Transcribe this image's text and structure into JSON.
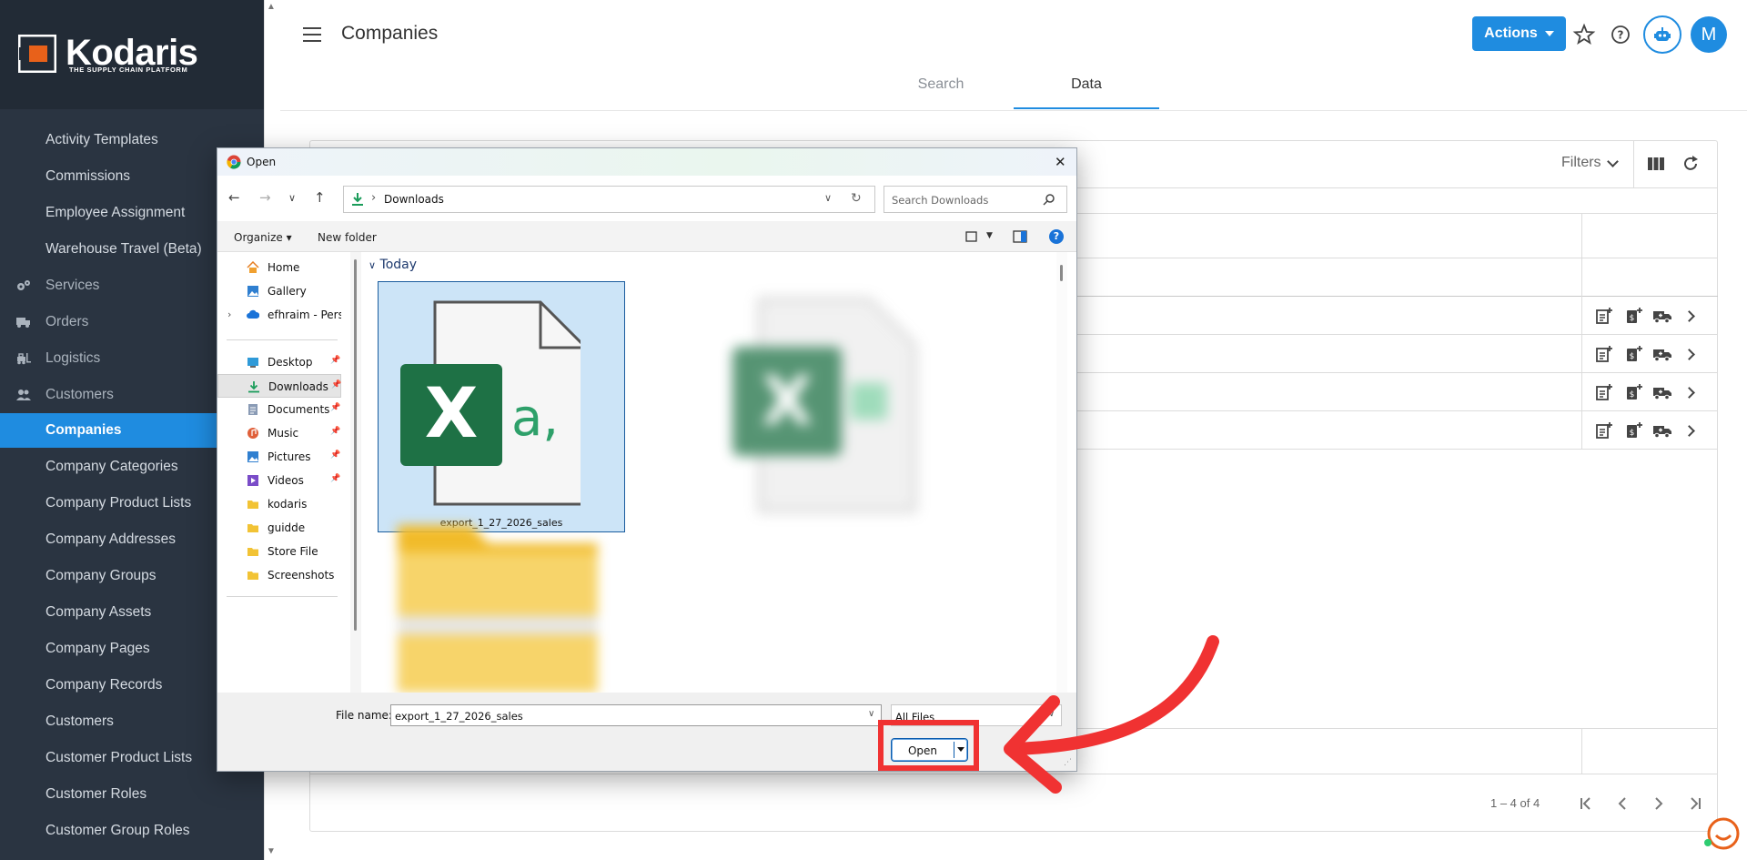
{
  "app": {
    "logo_text": "Kodaris",
    "logo_tagline": "THE SUPPLY CHAIN PLATFORM",
    "page_title": "Companies",
    "actions_label": "Actions",
    "avatar_initial": "M"
  },
  "tabs": [
    {
      "label": "Search",
      "active": false
    },
    {
      "label": "Data",
      "active": true
    }
  ],
  "sidebar": {
    "items": [
      {
        "label": "Activity Templates",
        "type": "child"
      },
      {
        "label": "Commissions",
        "type": "child"
      },
      {
        "label": "Employee Assignment",
        "type": "child"
      },
      {
        "label": "Warehouse Travel (Beta)",
        "type": "child"
      },
      {
        "label": "Services",
        "type": "parent",
        "icon": "gears-icon"
      },
      {
        "label": "Orders",
        "type": "parent",
        "icon": "truck-icon"
      },
      {
        "label": "Logistics",
        "type": "parent",
        "icon": "forklift-icon"
      },
      {
        "label": "Customers",
        "type": "parent",
        "icon": "people-icon"
      },
      {
        "label": "Companies",
        "type": "child",
        "active": true
      },
      {
        "label": "Company Categories",
        "type": "child"
      },
      {
        "label": "Company Product Lists",
        "type": "child"
      },
      {
        "label": "Company Addresses",
        "type": "child"
      },
      {
        "label": "Company Groups",
        "type": "child"
      },
      {
        "label": "Company Assets",
        "type": "child"
      },
      {
        "label": "Company Pages",
        "type": "child"
      },
      {
        "label": "Company Records",
        "type": "child"
      },
      {
        "label": "Customers",
        "type": "child"
      },
      {
        "label": "Customer Product Lists",
        "type": "child"
      },
      {
        "label": "Customer Roles",
        "type": "child"
      },
      {
        "label": "Customer Group Roles",
        "type": "child"
      }
    ]
  },
  "table": {
    "filters_label": "Filters",
    "pager_text": "1 – 4 of 4"
  },
  "dialog": {
    "title": "Open",
    "address_path": "Downloads",
    "search_placeholder": "Search Downloads",
    "organize_label": "Organize",
    "new_folder_label": "New folder",
    "nav_pane": [
      {
        "label": "Home",
        "icon": "home-icon"
      },
      {
        "label": "Gallery",
        "icon": "gallery-icon"
      },
      {
        "label": "efhraim - Personal",
        "icon": "onedrive-cloud-icon",
        "expandable": true
      },
      {
        "label": "Desktop",
        "icon": "desktop-icon",
        "pinned": true
      },
      {
        "label": "Downloads",
        "icon": "download-icon",
        "pinned": true,
        "selected": true
      },
      {
        "label": "Documents",
        "icon": "documents-icon",
        "pinned": true
      },
      {
        "label": "Music",
        "icon": "music-icon",
        "pinned": true
      },
      {
        "label": "Pictures",
        "icon": "pictures-icon",
        "pinned": true
      },
      {
        "label": "Videos",
        "icon": "videos-icon",
        "pinned": true
      },
      {
        "label": "kodaris",
        "icon": "folder-icon"
      },
      {
        "label": "guidde",
        "icon": "folder-icon"
      },
      {
        "label": "Store File",
        "icon": "folder-icon"
      },
      {
        "label": "Screenshots",
        "icon": "folder-icon"
      }
    ],
    "group_label": "Today",
    "selected_file": "export_1_27_2026_sales",
    "file_name_label": "File name:",
    "file_name_value": "export_1_27_2026_sales",
    "file_type_value": "All Files",
    "open_label": "Open"
  },
  "colors": {
    "sidebar_bg": "#2a3441",
    "accent": "#1f8ce0",
    "excel_green": "#1e7145",
    "annotation_red": "#f03232"
  }
}
